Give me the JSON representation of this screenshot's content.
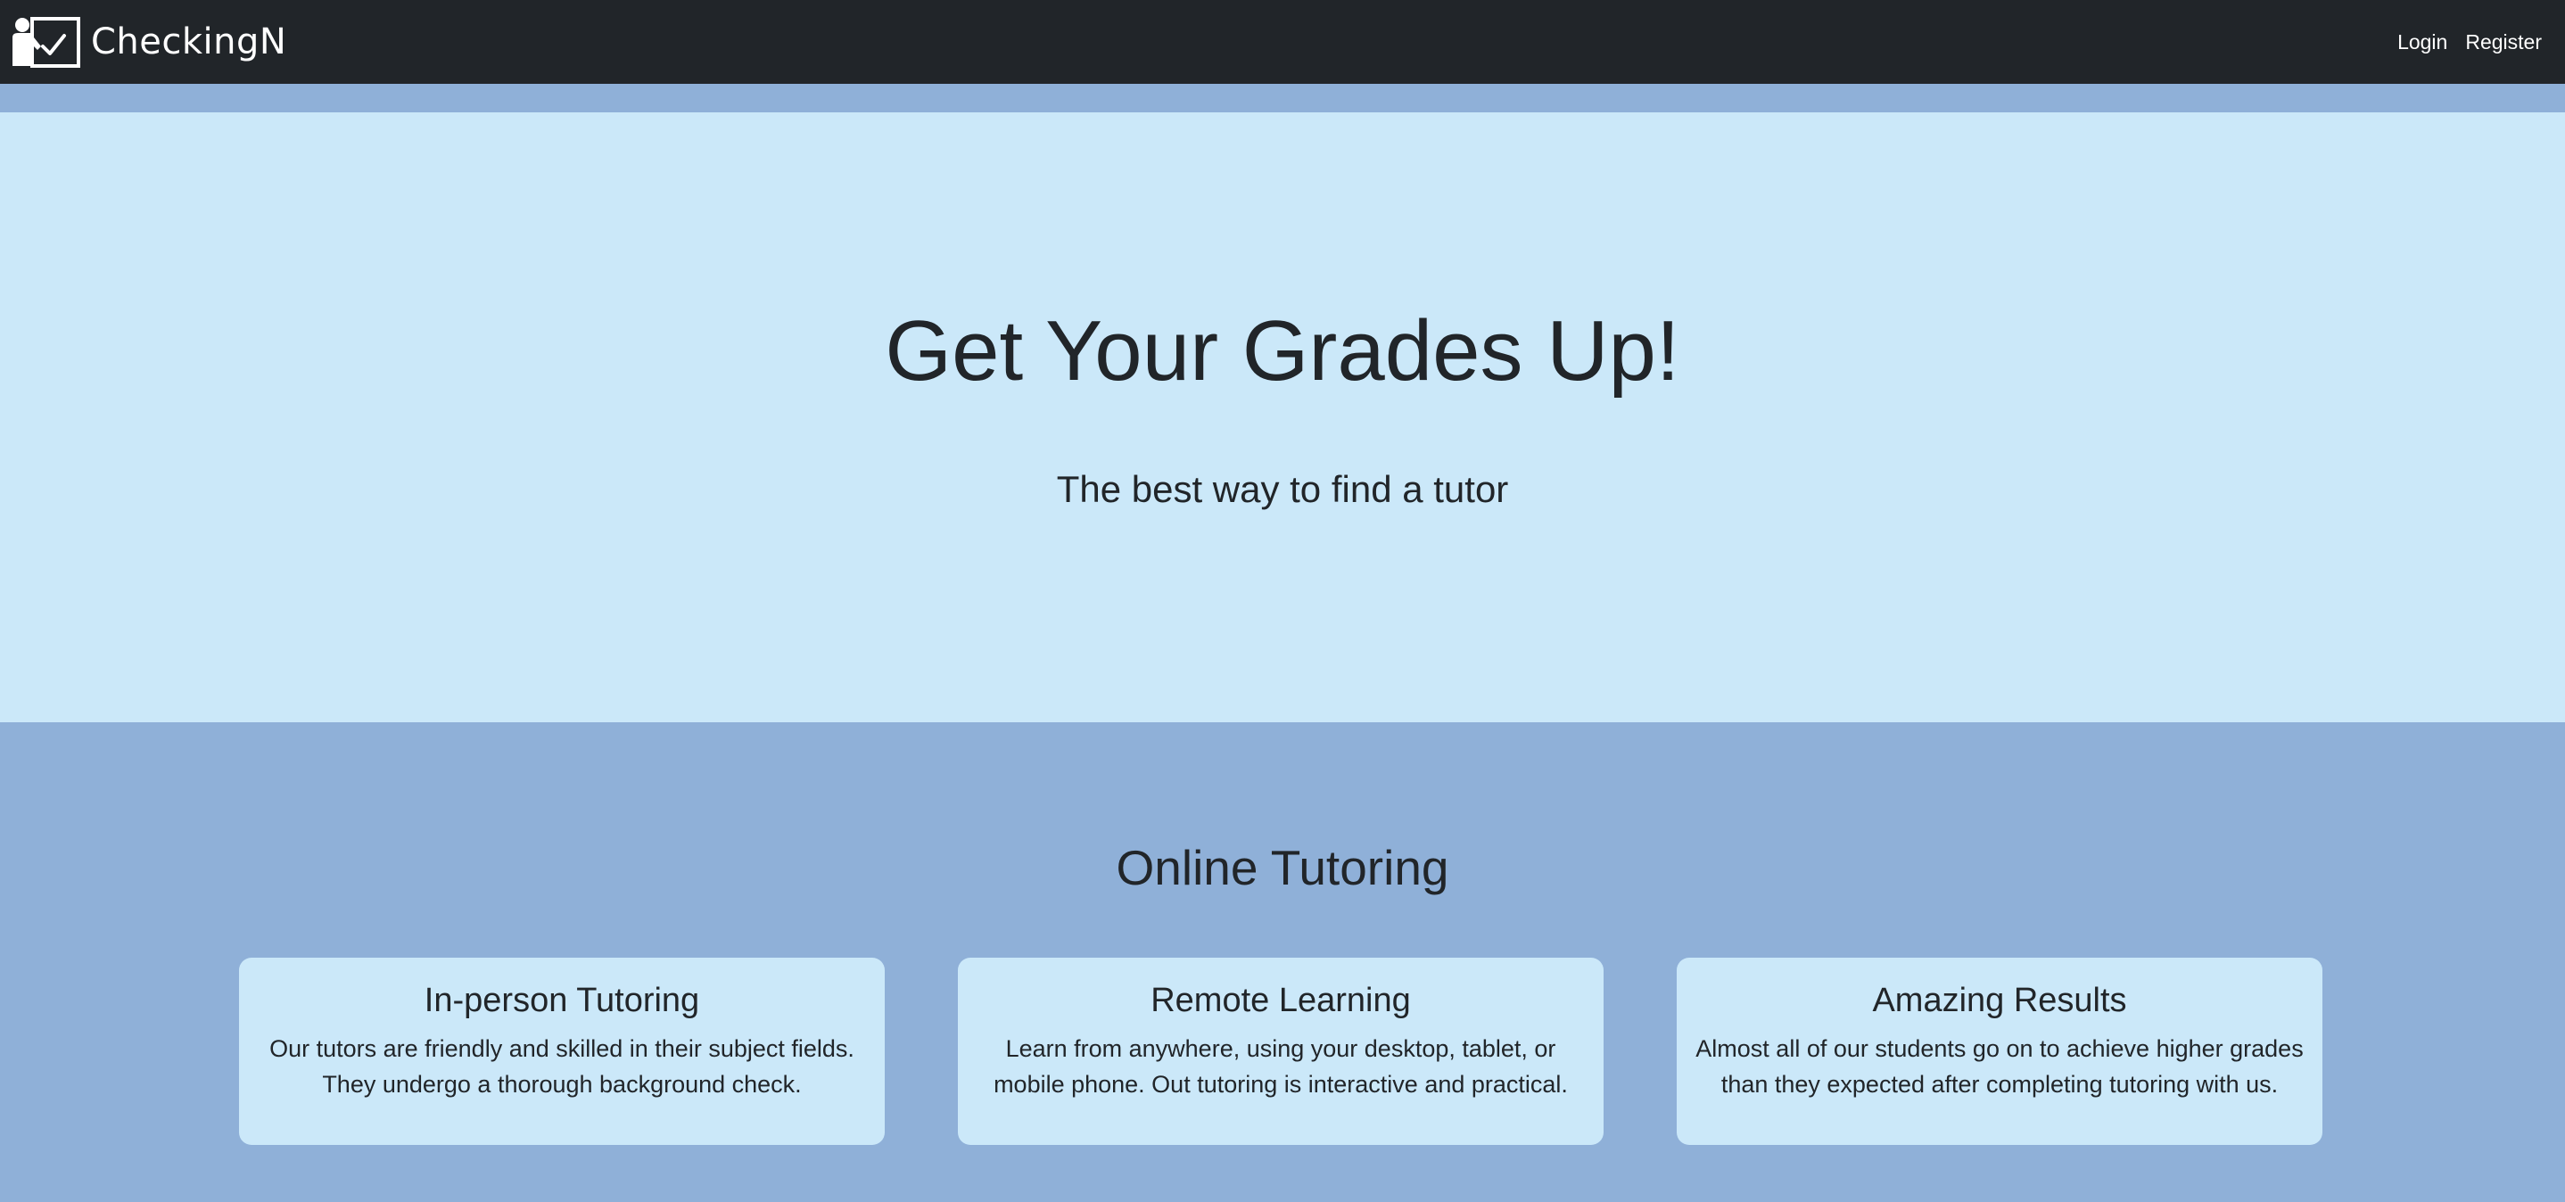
{
  "nav": {
    "brand": "CheckingN",
    "links": [
      "Login",
      "Register"
    ]
  },
  "hero": {
    "title": "Get Your Grades Up!",
    "subtitle": "The best way to find a tutor"
  },
  "features": {
    "title": "Online Tutoring",
    "cards": [
      {
        "title": "In-person Tutoring",
        "text": "Our tutors are friendly and skilled in their subject fields. They undergo a thorough background check."
      },
      {
        "title": "Remote Learning",
        "text": "Learn from anywhere, using your desktop, tablet, or mobile phone. Out tutoring is interactive and practical."
      },
      {
        "title": "Amazing Results",
        "text": "Almost all of our students go on to achieve higher grades than they expected after completing tutoring with us."
      }
    ]
  },
  "colors": {
    "navbar": "#212529",
    "hero_bg": "#cbe8f9",
    "section_bg": "#8fb0d8",
    "card_bg": "#cbe8f9",
    "text": "#212529"
  },
  "icons": {
    "brand_logo": "teacher-board-icon"
  }
}
